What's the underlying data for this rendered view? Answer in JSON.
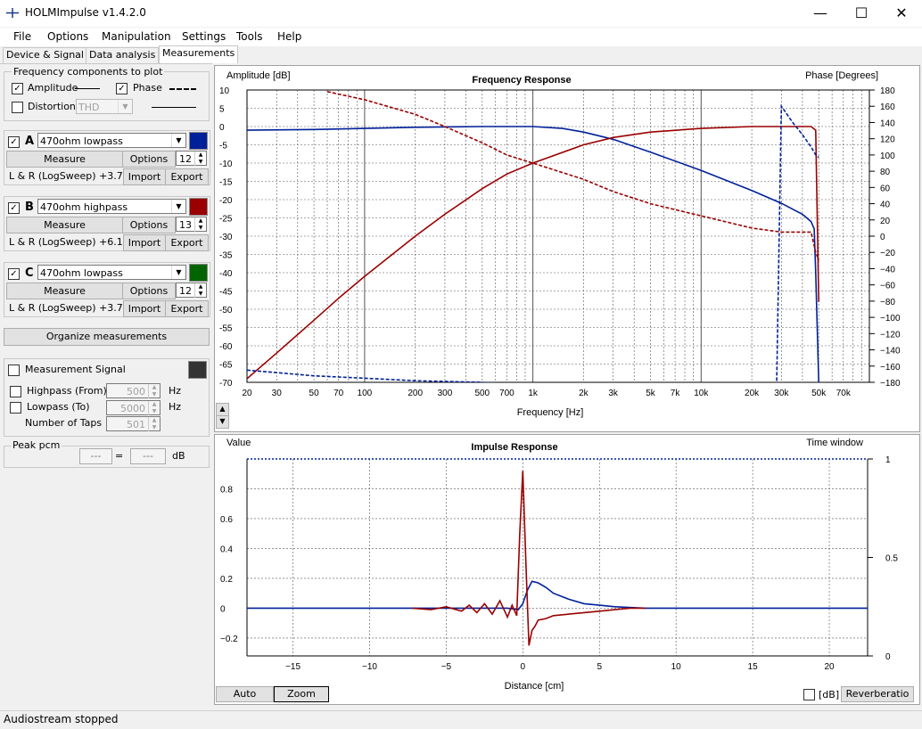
{
  "window": {
    "title": "HOLMImpulse  v1.4.2.0",
    "min": "—",
    "max": "☐",
    "close": "✕"
  },
  "menu": [
    "File",
    "Options",
    "Manipulation",
    "Settings",
    "Tools",
    "Help"
  ],
  "tabs": [
    "Device & Signal",
    "Data analysis",
    "Measurements"
  ],
  "freq_components": {
    "title": "Frequency components to plot",
    "amplitude": "Amplitude",
    "phase": "Phase",
    "distortion": "Distortion",
    "distortion_type": "THD",
    "amplitude_checked": "✓",
    "phase_checked": "✓"
  },
  "measurements": [
    {
      "letter": "A",
      "checked": "✓",
      "name": "470ohm lowpass",
      "color": "#00209a",
      "taps": "12",
      "desc": "L & R (LogSweep) +3.7dB",
      "measure": "Measure",
      "options": "Options",
      "import": "Import",
      "export": "Export"
    },
    {
      "letter": "B",
      "checked": "✓",
      "name": "470ohm highpass",
      "color": "#9a0000",
      "taps": "13",
      "desc": "L & R (LogSweep) +6.1dB",
      "measure": "Measure",
      "options": "Options",
      "import": "Import",
      "export": "Export"
    },
    {
      "letter": "C",
      "checked": "✓",
      "name": "470ohm lowpass",
      "color": "#006400",
      "taps": "12",
      "desc": "L & R (LogSweep) +3.7dB",
      "measure": "Measure",
      "options": "Options",
      "import": "Import",
      "export": "Export"
    }
  ],
  "organize_label": "Organize measurements",
  "signal": {
    "label": "Measurement Signal",
    "swatch": "#333333",
    "highpass": "Highpass (From)",
    "highpass_value": "500",
    "lowpass": "Lowpass (To)",
    "lowpass_value": "5000",
    "taps_label": "Number of Taps",
    "taps_value": "501",
    "unit": "Hz"
  },
  "peak": {
    "title": "Peak pcm",
    "a": "---",
    "eq": "=",
    "b": "---",
    "unit": "dB"
  },
  "status": "Audiostream stopped",
  "freq_plot": {
    "title": "Frequency Response",
    "left_label": "Amplitude [dB]",
    "right_label": "Phase [Degrees]",
    "x_label": "Frequency [Hz]",
    "scroll_up": "▲",
    "scroll_down": "▼"
  },
  "impulse_plot": {
    "title": "Impulse Response",
    "left_label": "Value",
    "right_label": "Time window",
    "x_label": "Distance [cm]",
    "auto": "Auto",
    "zoom": "Zoom",
    "db_label": "[dB]",
    "reverb": "Reverberatio"
  },
  "chart_data": [
    {
      "type": "line",
      "title": "Frequency Response",
      "xlabel": "Frequency [Hz]",
      "ylabel": "Amplitude [dB]",
      "y2label": "Phase [Degrees]",
      "xscale": "log",
      "xlim": [
        20,
        100000
      ],
      "ylim": [
        -70,
        10
      ],
      "y2lim": [
        -180,
        180
      ],
      "x_ticks": [
        "20",
        "30",
        "50",
        "70",
        "100",
        "200",
        "300",
        "500",
        "700",
        "1k",
        "2k",
        "3k",
        "5k",
        "7k",
        "10k",
        "20k",
        "30k",
        "50k",
        "70k"
      ],
      "x_tick_values": [
        20,
        30,
        50,
        70,
        100,
        200,
        300,
        500,
        700,
        1000,
        2000,
        3000,
        5000,
        7000,
        10000,
        20000,
        30000,
        50000,
        70000
      ],
      "y_ticks": [
        10,
        5,
        0,
        -5,
        -10,
        -15,
        -20,
        -25,
        -30,
        -35,
        -40,
        -45,
        -50,
        -55,
        -60,
        -65,
        -70
      ],
      "y2_ticks": [
        180,
        160,
        140,
        120,
        100,
        80,
        60,
        40,
        20,
        0,
        -20,
        -40,
        -60,
        -80,
        -100,
        -120,
        -140,
        -160,
        -180
      ],
      "grid": true,
      "series": [
        {
          "color": "#00209a",
          "style": "solid",
          "axis": "left",
          "x": [
            20,
            50,
            100,
            200,
            500,
            1000,
            1500,
            2000,
            3000,
            5000,
            10000,
            20000,
            30000,
            40000,
            45000,
            47000,
            48000,
            50000
          ],
          "y": [
            -1,
            -0.8,
            -0.5,
            -0.2,
            0,
            0,
            -0.5,
            -1.5,
            -3.5,
            -7,
            -12,
            -17.5,
            -21,
            -24,
            -26,
            -28,
            -40,
            -70
          ]
        },
        {
          "color": "#9a0000",
          "style": "solid",
          "axis": "left",
          "x": [
            20,
            30,
            50,
            70,
            100,
            200,
            300,
            500,
            700,
            1000,
            2000,
            3000,
            5000,
            10000,
            20000,
            30000,
            40000,
            45000,
            48000,
            50000
          ],
          "y": [
            -69,
            -62,
            -53,
            -47,
            -41,
            -30,
            -24,
            -17,
            -13,
            -10,
            -5,
            -3,
            -1.5,
            -0.5,
            0,
            0,
            0,
            0,
            -1,
            -48
          ]
        },
        {
          "color": "#00209a",
          "style": "dashed",
          "axis": "right",
          "x": [
            20,
            50,
            100,
            200,
            500,
            1000,
            2000,
            3000,
            5000,
            10000,
            20000,
            28000,
            30000,
            35000,
            40000,
            45000,
            48000,
            50000
          ],
          "y": [
            -165,
            -172,
            -175,
            -178,
            -180,
            -185,
            -205,
            -220,
            -240,
            -262,
            -300,
            -330,
            160,
            140,
            125,
            110,
            100,
            97
          ]
        },
        {
          "color": "#9a0000",
          "style": "dashed",
          "axis": "right",
          "x": [
            60,
            100,
            200,
            300,
            500,
            700,
            1000,
            2000,
            3000,
            5000,
            10000,
            20000,
            30000,
            40000,
            45000,
            48000,
            50000
          ],
          "y": [
            178,
            168,
            150,
            135,
            115,
            100,
            90,
            70,
            55,
            40,
            25,
            10,
            5,
            5,
            5,
            -20,
            -30
          ]
        }
      ]
    },
    {
      "type": "line",
      "title": "Impulse Response",
      "xlabel": "Distance [cm]",
      "ylabel": "Value",
      "y2label": "Time window",
      "xlim": [
        -18,
        22.5
      ],
      "ylim": [
        -0.32,
        1.0
      ],
      "y2lim": [
        0,
        1
      ],
      "x_ticks": [
        "−15",
        "−10",
        "−5",
        "0",
        "5",
        "10",
        "15",
        "20"
      ],
      "x_tick_values": [
        -15,
        -10,
        -5,
        0,
        5,
        10,
        15,
        20
      ],
      "y_ticks": [
        "0.8",
        "0.6",
        "0.4",
        "0.2",
        "0",
        "−0.2"
      ],
      "y_tick_values": [
        0.8,
        0.6,
        0.4,
        0.2,
        0,
        -0.2
      ],
      "y2_ticks": [
        "1",
        "0.5",
        "0"
      ],
      "y2_tick_values": [
        1,
        0.5,
        0
      ],
      "grid": true,
      "window_level": 1,
      "series": [
        {
          "color": "#00209a",
          "style": "solid",
          "x": [
            -18,
            -7,
            -1,
            -0.3,
            0,
            0.3,
            0.6,
            1,
            1.5,
            2,
            3,
            4,
            5,
            6,
            8,
            22.5
          ],
          "y": [
            0,
            0,
            0,
            -0.01,
            0.03,
            0.12,
            0.18,
            0.17,
            0.14,
            0.1,
            0.06,
            0.03,
            0.02,
            0.01,
            0,
            0
          ]
        },
        {
          "color": "#9a0000",
          "style": "solid",
          "x": [
            -7.2,
            -6,
            -5,
            -4,
            -3.5,
            -3,
            -2.5,
            -2,
            -1.5,
            -1,
            -0.7,
            -0.4,
            -0.2,
            0,
            0.2,
            0.4,
            0.6,
            0.8,
            1,
            1.5,
            2,
            3,
            4,
            5,
            6,
            7,
            8
          ],
          "y": [
            0,
            -0.01,
            0.01,
            -0.02,
            0.02,
            -0.03,
            0.03,
            -0.04,
            0.05,
            -0.06,
            0.02,
            -0.05,
            0.5,
            0.92,
            0.3,
            -0.25,
            -0.15,
            -0.12,
            -0.08,
            -0.07,
            -0.05,
            -0.04,
            -0.03,
            -0.02,
            -0.01,
            0,
            0
          ]
        }
      ]
    }
  ]
}
